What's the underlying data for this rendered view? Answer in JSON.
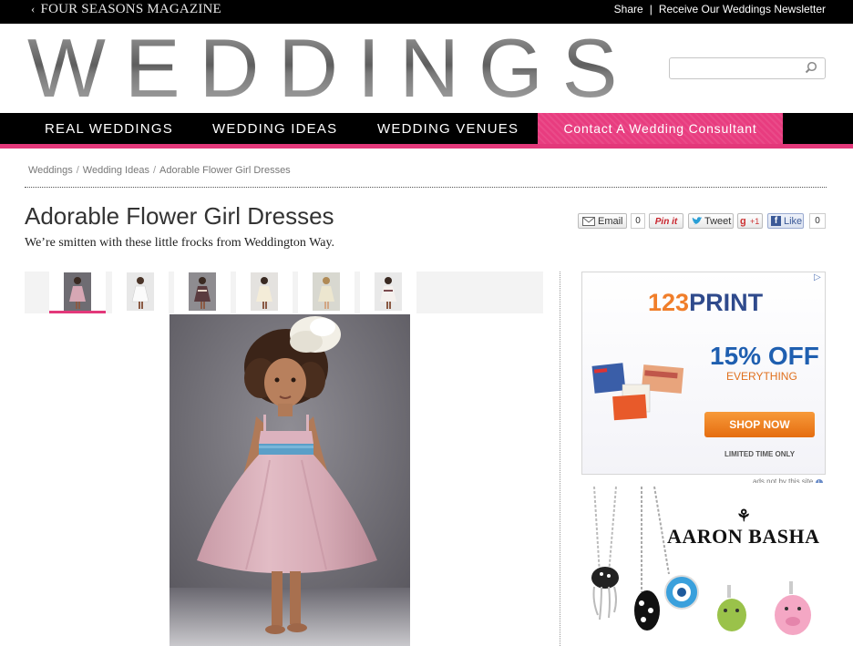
{
  "topbar": {
    "back_label": "FOUR SEASONS MAGAZINE",
    "share_label": "Share",
    "newsletter_label": "Receive Our Weddings Newsletter"
  },
  "header": {
    "logo_text": "WEDDINGS",
    "search_placeholder": ""
  },
  "nav": {
    "items": [
      "REAL WEDDINGS",
      "WEDDING IDEAS",
      "WEDDING VENUES"
    ],
    "contact_label": "Contact A Wedding Consultant"
  },
  "breadcrumb": [
    "Weddings",
    "Wedding Ideas",
    "Adorable Flower Girl Dresses"
  ],
  "article": {
    "title": "Adorable Flower Girl Dresses",
    "subtitle": "We’re smitten with these little frocks from Weddington Way."
  },
  "share": {
    "email_label": "Email",
    "email_count": "0",
    "pin_label": "Pin it",
    "tweet_label": "Tweet",
    "gplus_label": "+1",
    "like_label": "Like",
    "like_count": "0"
  },
  "gallery": {
    "thumb_count": 6,
    "active_index": 0
  },
  "ads": {
    "ad1": {
      "brand": "123PRINT",
      "offer": "15% OFF",
      "sub": "EVERYTHING",
      "cta": "SHOP NOW",
      "fine": "LIMITED TIME ONLY"
    },
    "ads_not_by": "ads not by this site",
    "ad2": {
      "brand": "AARON BASHA"
    }
  },
  "colors": {
    "accent_pink": "#e3387a",
    "nav_black": "#000000",
    "ad_blue": "#1f5fb0",
    "ad_orange": "#f07e2a"
  }
}
